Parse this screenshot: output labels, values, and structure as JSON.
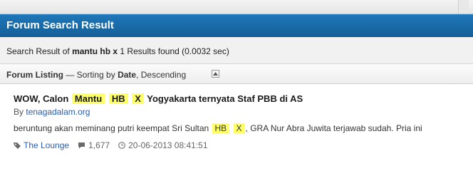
{
  "header": {
    "title": "Forum Search Result"
  },
  "summary": {
    "prefix": "Search Result of",
    "query": "mantu hb x",
    "results": "1 Results found (0.0032 sec)"
  },
  "listing": {
    "label": "Forum Listing",
    "sort_prefix": "— Sorting by",
    "sort_field": "Date",
    "sort_order": ", Descending"
  },
  "result": {
    "title_before": "WOW, Calon",
    "title_hl1": "Mantu",
    "title_hl2": "HB",
    "title_hl3": "X",
    "title_after": "Yogyakarta ternyata Staf PBB di AS",
    "by_label": "By",
    "author": "tenagadalam.org",
    "snippet_before": "beruntung akan meminang putri keempat Sri Sultan",
    "snippet_hl1": "HB",
    "snippet_hl2": "X",
    "snippet_after": ", GRA Nur Abra Juwita terjawab sudah. Pria ini",
    "category": "The Lounge",
    "replies": "1,677",
    "date": "20-06-2013 08:41:51"
  },
  "colors": {
    "header_bg": "#1a6dad",
    "highlight": "#ffff66",
    "link": "#2a5db0"
  },
  "icons": [
    "chevron-up-icon",
    "tag-icon",
    "comment-icon",
    "clock-icon"
  ]
}
